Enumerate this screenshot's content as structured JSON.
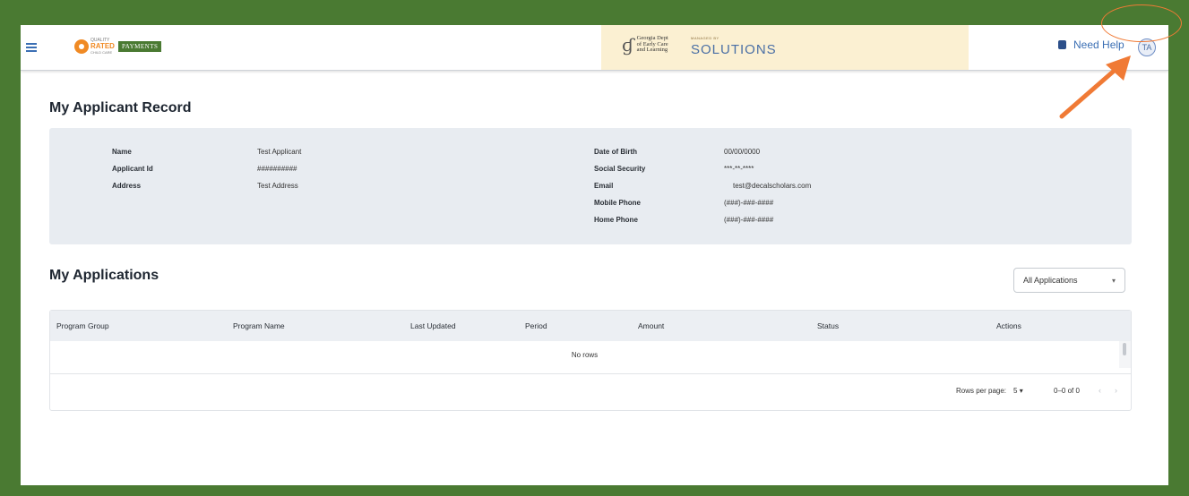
{
  "header": {
    "logo_line1": "QUALITY",
    "logo_line2": "RATED",
    "logo_line3": "CHILD CARE",
    "payments_badge": "PAYMENTS",
    "decal_line1": "Georgia Dept",
    "decal_line2": "of Early Care",
    "decal_line3": "and Learning",
    "managed_by": "MANAGED BY",
    "solutions": "SOLUTIONS",
    "need_help": "Need Help",
    "avatar_initials": "TA"
  },
  "applicant_record": {
    "title": "My Applicant Record",
    "left_fields": [
      {
        "label": "Name",
        "value": "Test Applicant"
      },
      {
        "label": "Applicant Id",
        "value": "##########"
      },
      {
        "label": "Address",
        "value": "Test Address"
      }
    ],
    "right_fields": [
      {
        "label": "Date of Birth",
        "value": "00/00/0000"
      },
      {
        "label": "Social Security",
        "value": "***-**-****"
      },
      {
        "label": "Email",
        "value": "test@decalscholars.com"
      },
      {
        "label": "Mobile Phone",
        "value": "(###)-###-####"
      },
      {
        "label": "Home Phone",
        "value": "(###)-###-####"
      }
    ]
  },
  "applications": {
    "title": "My Applications",
    "filter_selected": "All Applications",
    "columns": [
      "Program Group",
      "Program Name",
      "Last Updated",
      "Period",
      "Amount",
      "Status",
      "Actions"
    ],
    "empty_message": "No rows",
    "rows_per_page_label": "Rows per page:",
    "rows_per_page": "5",
    "range": "0–0 of 0"
  },
  "colors": {
    "background_frame": "#4a7a32",
    "accent_blue": "#3b6fb4",
    "highlight_orange": "#f07a35",
    "banner_cream": "#fbf0d2"
  },
  "icons": {
    "menu": "hamburger-menu-icon",
    "help": "help-book-icon",
    "prev_page": "chevron-left-icon",
    "next_page": "chevron-right-icon",
    "dropdown": "caret-down-icon"
  }
}
